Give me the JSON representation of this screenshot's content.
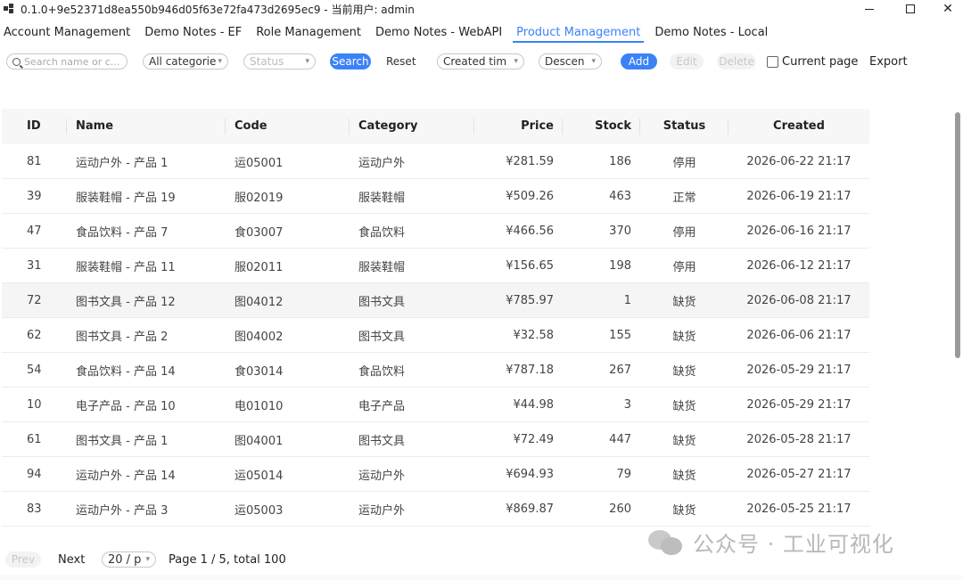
{
  "window": {
    "title": "0.1.0+9e52371d8ea550b946d05f63e72fa473d2695ec9 - 当前用户: admin",
    "minimize": "—",
    "maximize": "□",
    "close": "✕"
  },
  "tabs": [
    {
      "label": "Account Management"
    },
    {
      "label": "Demo Notes - EF"
    },
    {
      "label": "Role Management"
    },
    {
      "label": "Demo Notes - WebAPI"
    },
    {
      "label": "Product Management",
      "active": true
    },
    {
      "label": "Demo Notes - Local"
    }
  ],
  "toolbar": {
    "search_placeholder": "Search name or c...",
    "category_value": "All categorie",
    "status_value": "Status",
    "search_label": "Search",
    "reset_label": "Reset",
    "sort_field_value": "Created tim",
    "sort_order_value": "Descen",
    "add_label": "Add",
    "edit_label": "Edit",
    "delete_label": "Delete",
    "current_page_label": "Current page",
    "export_label": "Export"
  },
  "table": {
    "headers": {
      "id": "ID",
      "name": "Name",
      "code": "Code",
      "category": "Category",
      "price": "Price",
      "stock": "Stock",
      "status": "Status",
      "created": "Created"
    },
    "rows": [
      {
        "id": "81",
        "name": "运动户外 - 产品 1",
        "code": "运05001",
        "category": "运动户外",
        "price": "¥281.59",
        "stock": "186",
        "status": "停用",
        "created": "2026-06-22 21:17"
      },
      {
        "id": "39",
        "name": "服装鞋帽 - 产品 19",
        "code": "服02019",
        "category": "服装鞋帽",
        "price": "¥509.26",
        "stock": "463",
        "status": "正常",
        "created": "2026-06-19 21:17"
      },
      {
        "id": "47",
        "name": "食品饮料 - 产品 7",
        "code": "食03007",
        "category": "食品饮料",
        "price": "¥466.56",
        "stock": "370",
        "status": "停用",
        "created": "2026-06-16 21:17"
      },
      {
        "id": "31",
        "name": "服装鞋帽 - 产品 11",
        "code": "服02011",
        "category": "服装鞋帽",
        "price": "¥156.65",
        "stock": "198",
        "status": "停用",
        "created": "2026-06-12 21:17"
      },
      {
        "id": "72",
        "name": "图书文具 - 产品 12",
        "code": "图04012",
        "category": "图书文具",
        "price": "¥785.97",
        "stock": "1",
        "status": "缺货",
        "created": "2026-06-08 21:17"
      },
      {
        "id": "62",
        "name": "图书文具 - 产品 2",
        "code": "图04002",
        "category": "图书文具",
        "price": "¥32.58",
        "stock": "155",
        "status": "缺货",
        "created": "2026-06-06 21:17"
      },
      {
        "id": "54",
        "name": "食品饮料 - 产品 14",
        "code": "食03014",
        "category": "食品饮料",
        "price": "¥787.18",
        "stock": "267",
        "status": "缺货",
        "created": "2026-05-29 21:17"
      },
      {
        "id": "10",
        "name": "电子产品 - 产品 10",
        "code": "电01010",
        "category": "电子产品",
        "price": "¥44.98",
        "stock": "3",
        "status": "缺货",
        "created": "2026-05-29 21:17"
      },
      {
        "id": "61",
        "name": "图书文具 - 产品 1",
        "code": "图04001",
        "category": "图书文具",
        "price": "¥72.49",
        "stock": "447",
        "status": "缺货",
        "created": "2026-05-28 21:17"
      },
      {
        "id": "94",
        "name": "运动户外 - 产品 14",
        "code": "运05014",
        "category": "运动户外",
        "price": "¥694.93",
        "stock": "79",
        "status": "缺货",
        "created": "2026-05-27 21:17"
      },
      {
        "id": "83",
        "name": "运动户外 - 产品 3",
        "code": "运05003",
        "category": "运动户外",
        "price": "¥869.87",
        "stock": "260",
        "status": "缺货",
        "created": "2026-05-25 21:17"
      }
    ]
  },
  "pager": {
    "prev_label": "Prev",
    "next_label": "Next",
    "page_size_value": "20 / p",
    "page_info": "Page 1 / 5, total 100"
  },
  "watermark": {
    "text": "公众号 · 工业可视化"
  },
  "colors": {
    "accent": "#3b82f6",
    "header_bg": "#f7f7f7",
    "highlight_row": "#f5f5f5"
  }
}
